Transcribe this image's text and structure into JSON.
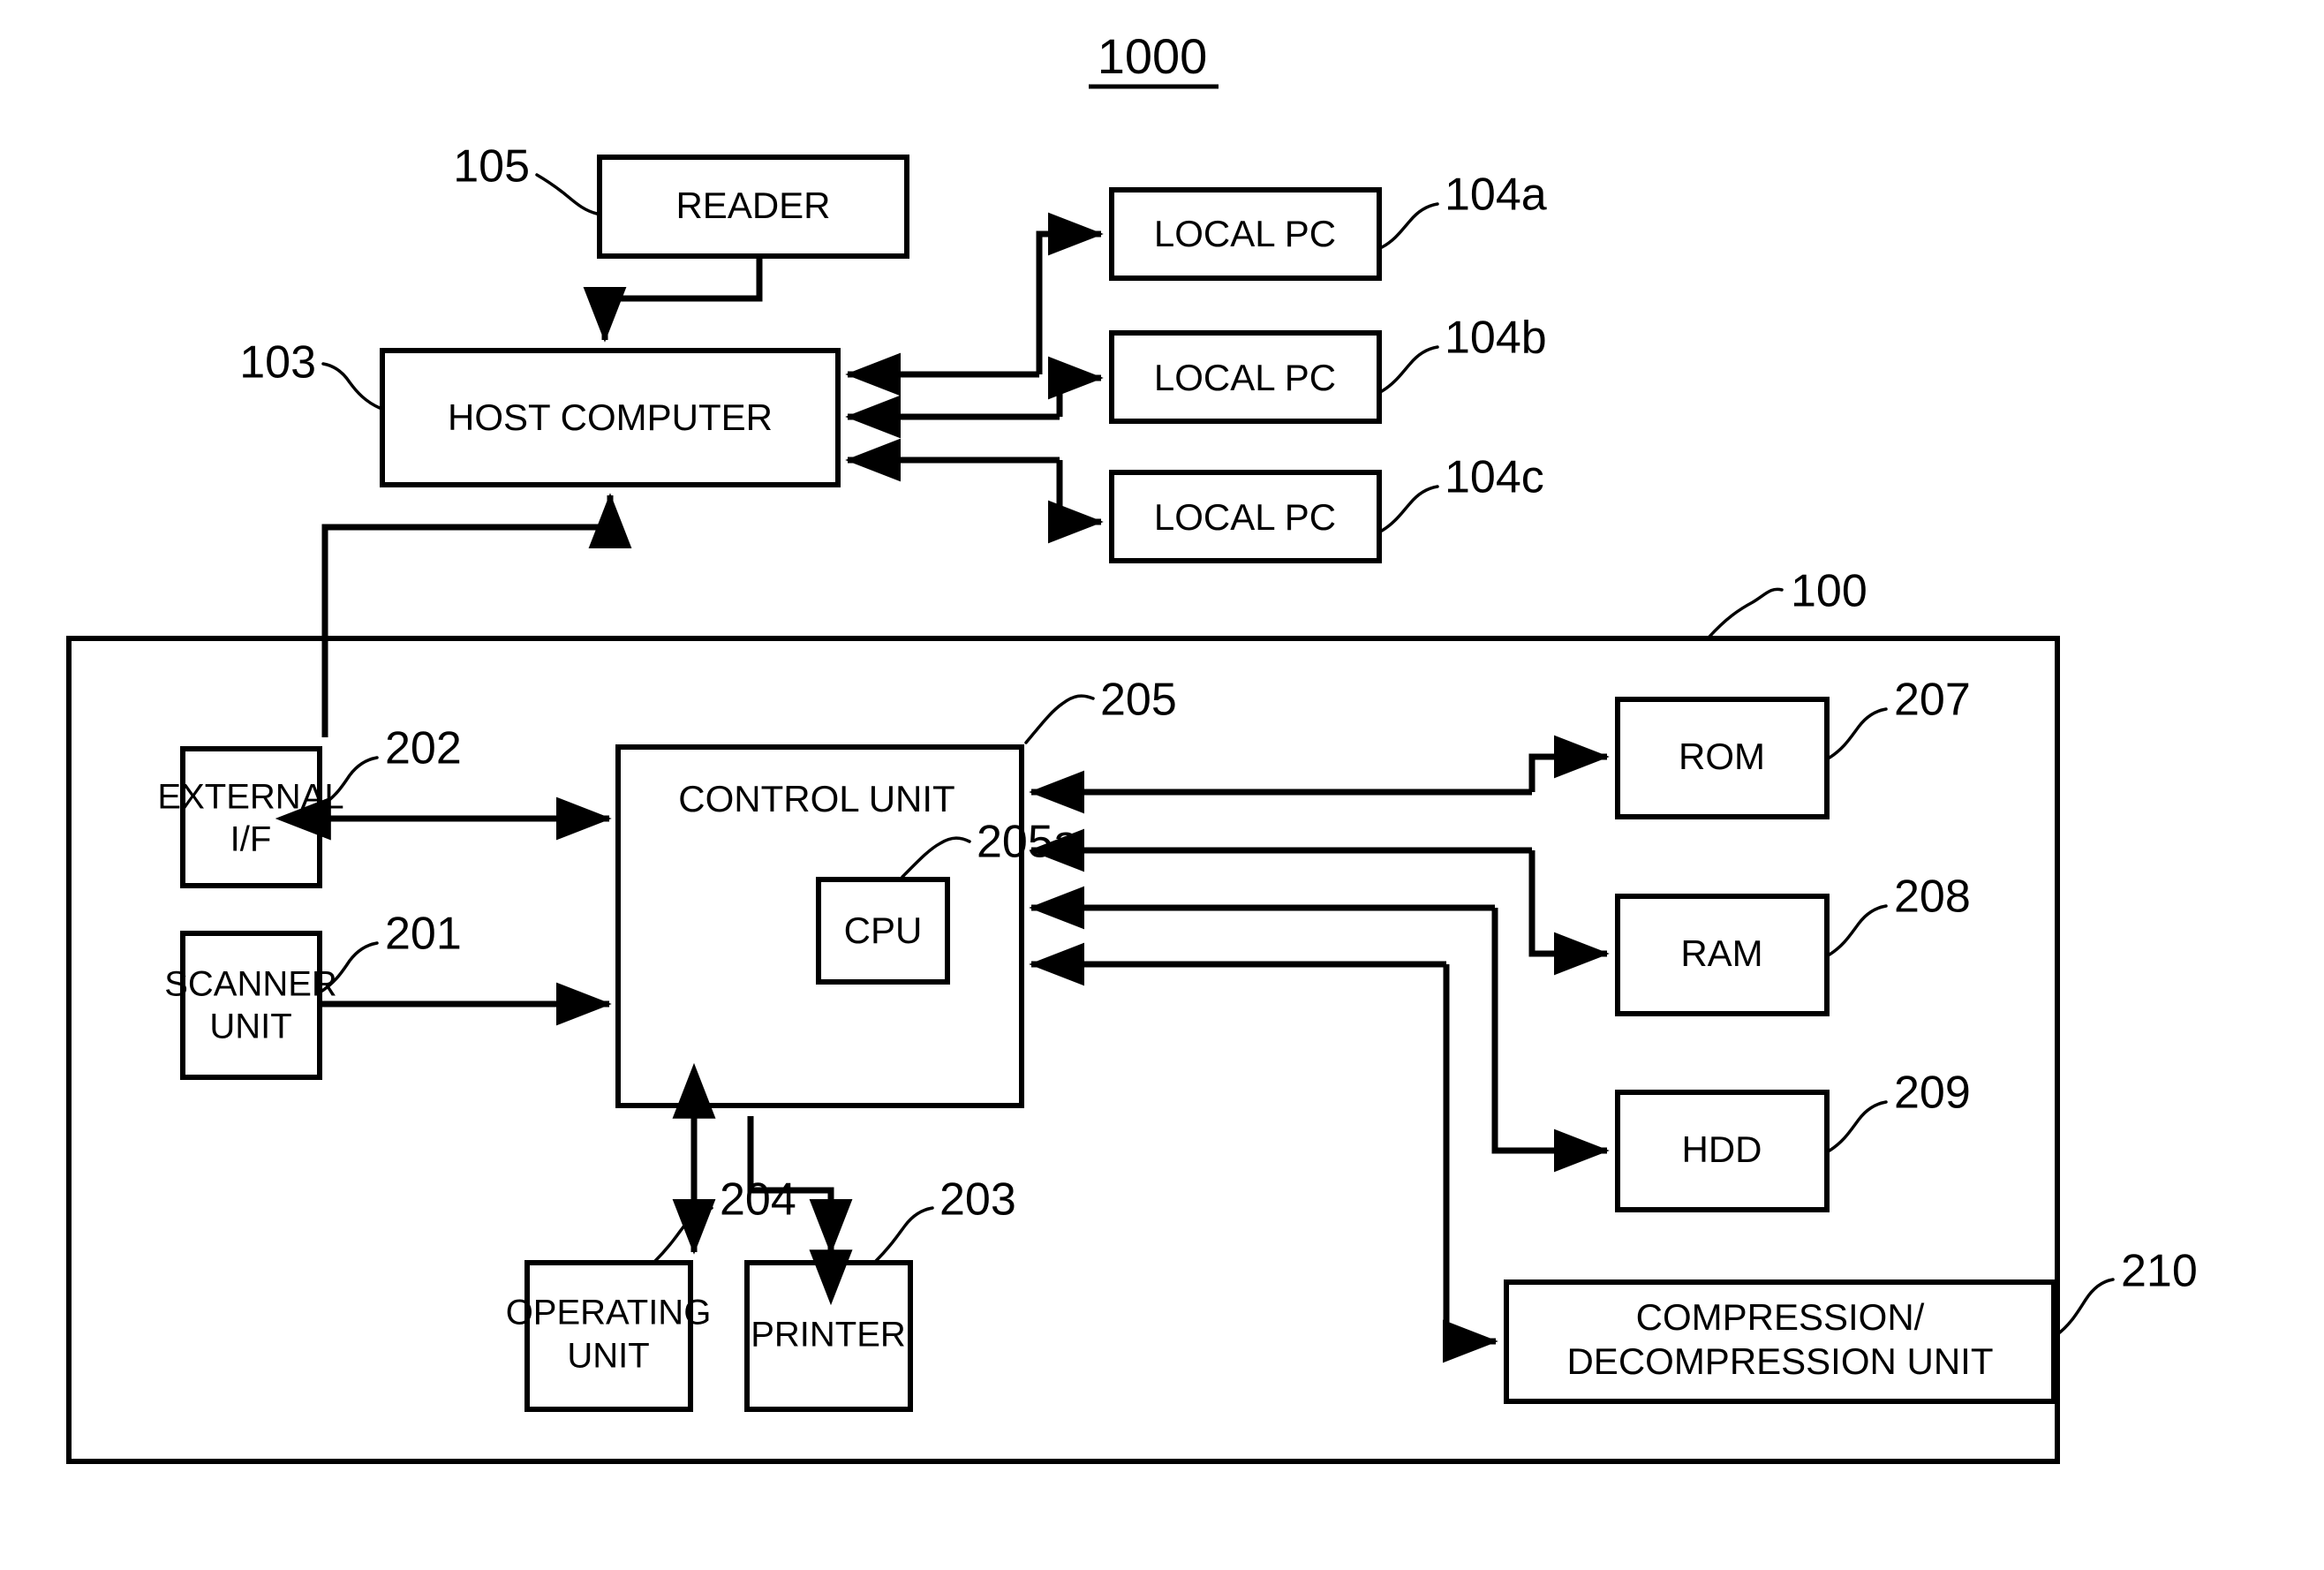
{
  "figure": {
    "title": "1000",
    "title_underlined": true,
    "type": "patent-block-diagram",
    "stroke_color": "#000000",
    "background_color": "#ffffff"
  },
  "blocks": {
    "reader": {
      "label": "READER",
      "ref": "105"
    },
    "host_computer": {
      "label": "HOST COMPUTER",
      "ref": "103"
    },
    "local_pc_a": {
      "label": "LOCAL PC",
      "ref": "104a"
    },
    "local_pc_b": {
      "label": "LOCAL PC",
      "ref": "104b"
    },
    "local_pc_c": {
      "label": "LOCAL PC",
      "ref": "104c"
    },
    "device": {
      "ref": "100"
    },
    "external_if": {
      "label_line1": "EXTERNAL",
      "label_line2": "I/F",
      "ref": "202"
    },
    "scanner_unit": {
      "label_line1": "SCANNER",
      "label_line2": "UNIT",
      "ref": "201"
    },
    "control_unit": {
      "label": "CONTROL UNIT",
      "ref": "205"
    },
    "cpu": {
      "label": "CPU",
      "ref": "205a"
    },
    "rom": {
      "label": "ROM",
      "ref": "207"
    },
    "ram": {
      "label": "RAM",
      "ref": "208"
    },
    "hdd": {
      "label": "HDD",
      "ref": "209"
    },
    "compression_unit": {
      "label_line1": "COMPRESSION/",
      "label_line2": "DECOMPRESSION UNIT",
      "ref": "210"
    },
    "operating_unit": {
      "label_line1": "OPERATING",
      "label_line2": "UNIT",
      "ref": "204"
    },
    "printer": {
      "label": "PRINTER",
      "ref": "203"
    }
  },
  "connections": [
    {
      "from": "reader",
      "to": "host_computer",
      "arrow": "single"
    },
    {
      "from": "local_pc_a",
      "to": "host_computer",
      "arrow": "double-separate"
    },
    {
      "from": "local_pc_b",
      "to": "host_computer",
      "arrow": "double-separate"
    },
    {
      "from": "local_pc_c",
      "to": "host_computer",
      "arrow": "double-separate"
    },
    {
      "from": "external_if",
      "to": "host_computer",
      "arrow": "single"
    },
    {
      "from": "external_if",
      "to": "control_unit",
      "arrow": "bidirectional"
    },
    {
      "from": "scanner_unit",
      "to": "control_unit",
      "arrow": "single"
    },
    {
      "from": "control_unit",
      "to": "operating_unit",
      "arrow": "bidirectional"
    },
    {
      "from": "control_unit",
      "to": "printer",
      "arrow": "single"
    },
    {
      "from": "control_unit",
      "to": "rom",
      "arrow": "double-separate"
    },
    {
      "from": "control_unit",
      "to": "ram",
      "arrow": "double-separate"
    },
    {
      "from": "control_unit",
      "to": "hdd",
      "arrow": "double-separate"
    },
    {
      "from": "control_unit",
      "to": "compression_unit",
      "arrow": "double-separate"
    }
  ]
}
